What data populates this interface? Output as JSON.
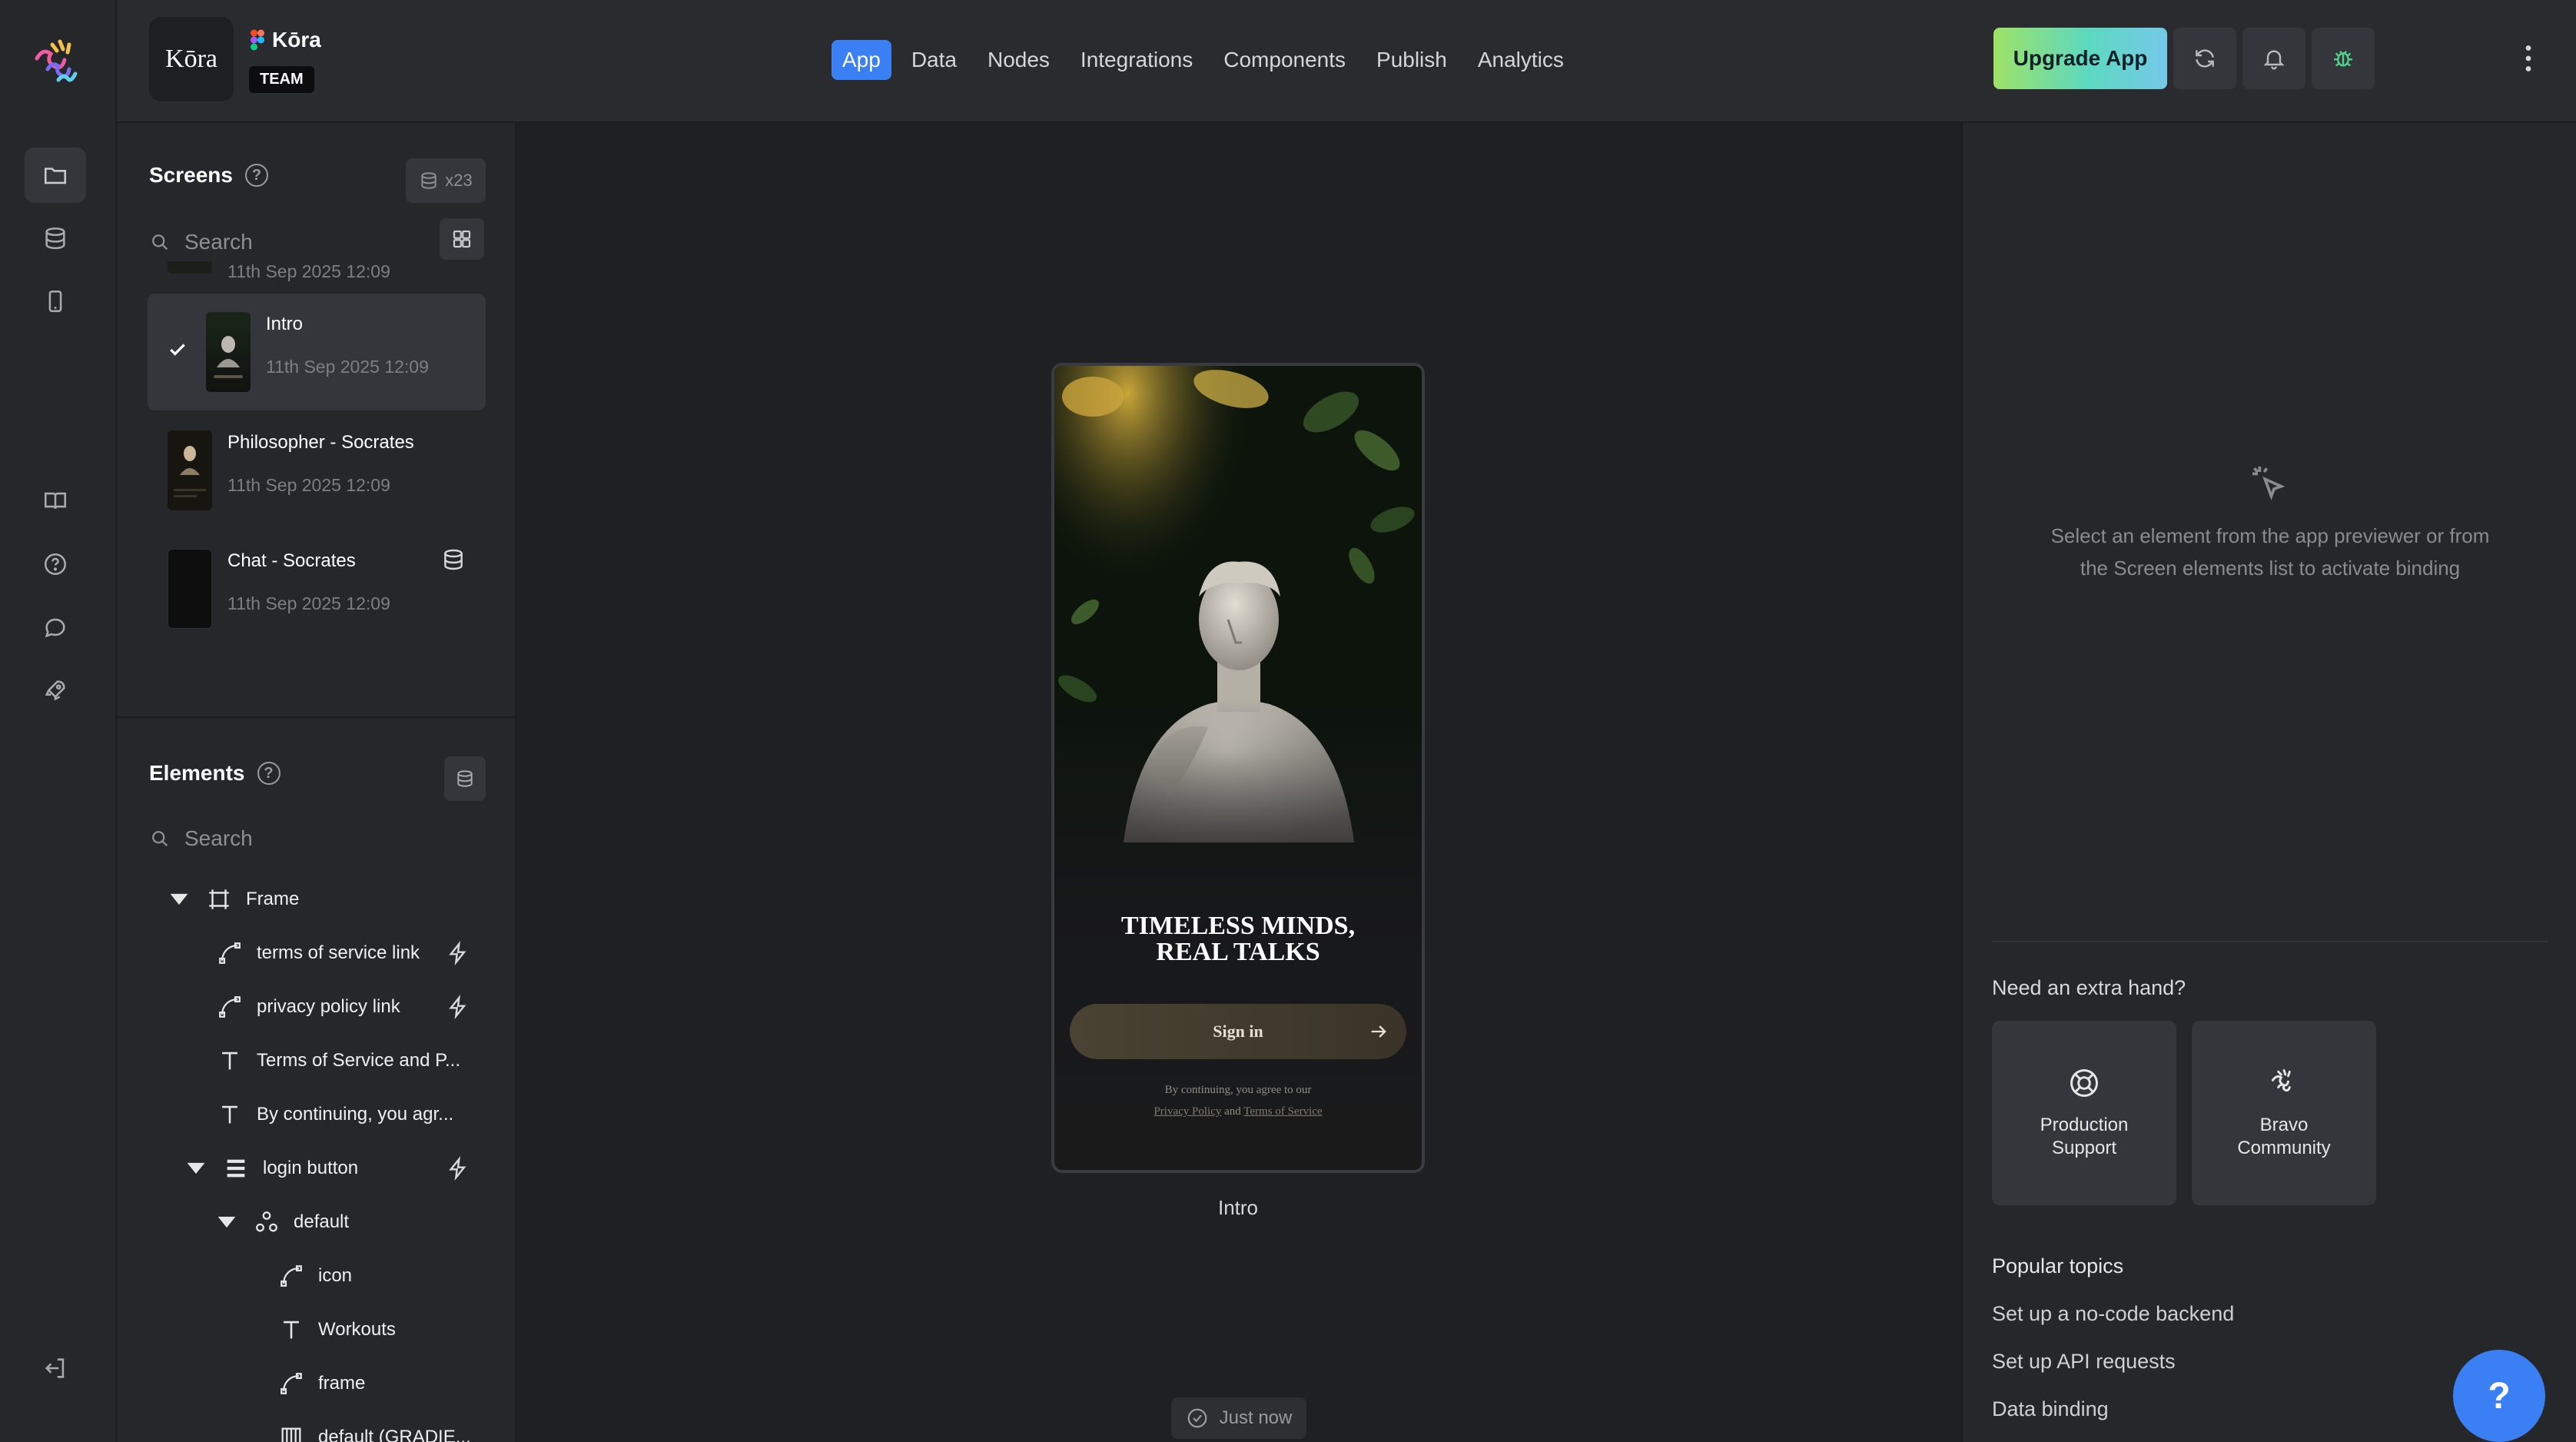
{
  "app": {
    "avatar_text": "Kōra",
    "name": "Kōra",
    "plan_badge": "TEAM"
  },
  "nav": {
    "items": [
      {
        "label": "App",
        "active": true
      },
      {
        "label": "Data"
      },
      {
        "label": "Nodes"
      },
      {
        "label": "Integrations"
      },
      {
        "label": "Components"
      },
      {
        "label": "Publish"
      },
      {
        "label": "Analytics"
      }
    ]
  },
  "toolbar": {
    "upgrade_label": "Upgrade App",
    "icons": [
      "refresh-icon",
      "bell-icon",
      "bug-icon",
      "more-vertical-icon",
      "eye-icon"
    ]
  },
  "rail": {
    "top_icons": [
      "folder-icon",
      "database-icon",
      "phone-icon"
    ],
    "mid_icons": [
      "book-icon",
      "help-icon",
      "chat-icon",
      "rocket-icon"
    ],
    "bottom_icons": [
      "logout-icon"
    ]
  },
  "screens": {
    "title": "Screens",
    "count_label": "x23",
    "search_placeholder": "Search",
    "items": [
      {
        "name": "",
        "time": "11th Sep 2025 12:09"
      },
      {
        "name": "Intro",
        "time": "11th Sep 2025 12:09",
        "selected": true
      },
      {
        "name": "Philosopher - Socrates",
        "time": "11th Sep 2025 12:09"
      },
      {
        "name": "Chat - Socrates",
        "time": "11th Sep 2025 12:09",
        "has_data": true
      }
    ]
  },
  "elements": {
    "title": "Elements",
    "search_placeholder": "Search",
    "tree": [
      {
        "label": "Frame",
        "icon": "frame-icon",
        "depth": 0,
        "expanded": true
      },
      {
        "label": "terms of service link",
        "icon": "vector-icon",
        "depth": 1,
        "action": true
      },
      {
        "label": "privacy policy link",
        "icon": "vector-icon",
        "depth": 1,
        "action": true
      },
      {
        "label": "Terms of Service and P...",
        "icon": "text-icon",
        "depth": 1
      },
      {
        "label": "By continuing, you agr...",
        "icon": "text-icon",
        "depth": 1
      },
      {
        "label": "login button",
        "icon": "list-icon",
        "depth": 1,
        "expanded": true,
        "action": true
      },
      {
        "label": "default",
        "icon": "component-icon",
        "depth": 2,
        "expanded": true
      },
      {
        "label": "icon",
        "icon": "vector-icon",
        "depth": 3
      },
      {
        "label": "Workouts",
        "icon": "text-icon",
        "depth": 3
      },
      {
        "label": "frame",
        "icon": "vector-icon",
        "depth": 3
      },
      {
        "label": "default (GRADIE...",
        "icon": "image-icon",
        "depth": 3
      }
    ]
  },
  "preview": {
    "headline_line1": "TIMELESS MINDS,",
    "headline_line2": "REAL TALKS",
    "signin_label": "Sign in",
    "fine_print_1": "By continuing, you agree to our",
    "privacy_link": "Privacy Policy",
    "and_text": "and",
    "terms_link": "Terms of Service",
    "caption": "Intro"
  },
  "status": {
    "saved_label": "Just now"
  },
  "inspector": {
    "empty_message": "Select an element from the app previewer or from the Screen elements list to activate binding",
    "extra_hand_title": "Need an extra hand?",
    "cards": [
      {
        "label_line1": "Production",
        "label_line2": "Support",
        "icon": "lifebuoy-icon"
      },
      {
        "label_line1": "Bravo",
        "label_line2": "Community",
        "icon": "bravo-icon"
      }
    ],
    "popular_title": "Popular topics",
    "topics": [
      "Set up a no-code backend",
      "Set up API requests",
      "Data binding"
    ]
  },
  "fab_label": "?",
  "colors": {
    "accent": "#3a7ff3",
    "upgrade_start": "#9ee266",
    "upgrade_end": "#73c9e8",
    "bg": "#1f2024",
    "panel": "#26272b"
  }
}
